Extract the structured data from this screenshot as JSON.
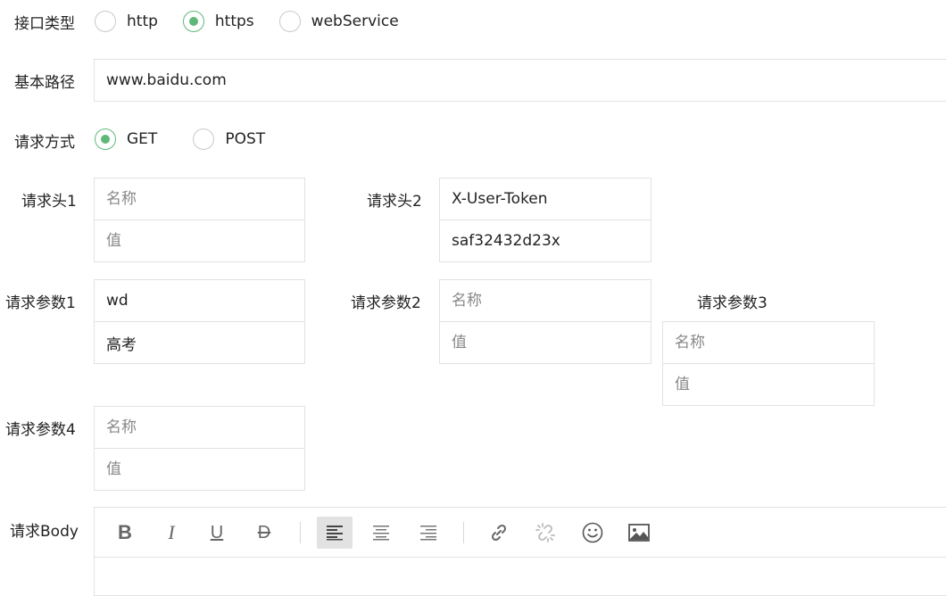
{
  "interface_type": {
    "label": "接口类型",
    "options": [
      {
        "label": "http",
        "checked": false
      },
      {
        "label": "https",
        "checked": true
      },
      {
        "label": "webService",
        "checked": false
      }
    ]
  },
  "base_path": {
    "label": "基本路径",
    "value": "www.baidu.com"
  },
  "request_method": {
    "label": "请求方式",
    "options": [
      {
        "label": "GET",
        "checked": true
      },
      {
        "label": "POST",
        "checked": false
      }
    ]
  },
  "placeholders": {
    "name": "名称",
    "value": "值"
  },
  "headers": [
    {
      "label": "请求头1",
      "name": "",
      "value": ""
    },
    {
      "label": "请求头2",
      "name": "X-User-Token",
      "value": "saf32432d23x"
    }
  ],
  "params": [
    {
      "label": "请求参数1",
      "name": "wd",
      "value": "高考"
    },
    {
      "label": "请求参数2",
      "name": "",
      "value": ""
    },
    {
      "label": "请求参数3",
      "name": "",
      "value": ""
    },
    {
      "label": "请求参数4",
      "name": "",
      "value": ""
    }
  ],
  "body": {
    "label": "请求Body",
    "toolbar": [
      {
        "icon": "bold-icon",
        "glyph": "B",
        "active": false
      },
      {
        "icon": "italic-icon",
        "glyph": "I",
        "active": false
      },
      {
        "icon": "underline-icon",
        "glyph": "U",
        "active": false
      },
      {
        "icon": "strikethrough-icon",
        "glyph": "D",
        "active": false
      },
      {
        "icon": "align-left-icon",
        "glyph": "",
        "active": true
      },
      {
        "icon": "align-center-icon",
        "glyph": "",
        "active": false
      },
      {
        "icon": "align-right-icon",
        "glyph": "",
        "active": false
      },
      {
        "icon": "link-icon",
        "glyph": "",
        "active": false
      },
      {
        "icon": "unlink-icon",
        "glyph": "",
        "active": false
      },
      {
        "icon": "emoji-icon",
        "glyph": "☺",
        "active": false
      },
      {
        "icon": "image-icon",
        "glyph": "",
        "active": false
      }
    ]
  },
  "colors": {
    "accent": "#5fb878",
    "border": "#e2e2e2",
    "placeholder": "#888888"
  }
}
